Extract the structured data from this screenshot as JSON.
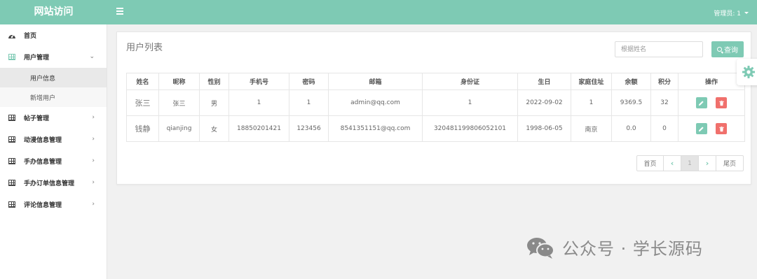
{
  "header": {
    "logo": "网站访问",
    "admin_label": "管理员: 1"
  },
  "sidebar": {
    "items": [
      {
        "label": "首页",
        "icon": "dashboard-icon"
      },
      {
        "label": "用户管理",
        "icon": "table-icon",
        "open": true,
        "children": [
          {
            "label": "用户信息",
            "active": true
          },
          {
            "label": "新增用户"
          }
        ]
      },
      {
        "label": "帖子管理",
        "icon": "table-icon"
      },
      {
        "label": "动漫信息管理",
        "icon": "table-icon"
      },
      {
        "label": "手办信息管理",
        "icon": "table-icon"
      },
      {
        "label": "手办订单信息管理",
        "icon": "table-icon"
      },
      {
        "label": "评论信息管理",
        "icon": "table-icon"
      }
    ]
  },
  "main": {
    "title": "用户列表",
    "search": {
      "placeholder": "根据姓名",
      "value": "",
      "button_label": "查询"
    },
    "table": {
      "headers": [
        "姓名",
        "昵称",
        "性别",
        "手机号",
        "密码",
        "邮箱",
        "身份证",
        "生日",
        "家庭住址",
        "余额",
        "积分",
        "操作"
      ],
      "rows": [
        [
          "张三",
          "张三",
          "男",
          "1",
          "1",
          "admin@qq.com",
          "1",
          "2022-09-02",
          "1",
          "9369.5",
          "32"
        ],
        [
          "钱静",
          "qianjing",
          "女",
          "18850201421",
          "123456",
          "8541351151@qq.com",
          "320481199806052101",
          "1998-06-05",
          "南京",
          "0.0",
          "0"
        ]
      ]
    },
    "pagination": {
      "first": "首页",
      "current": "1",
      "last": "尾页"
    }
  },
  "watermark": "公众号 · 学长源码",
  "colors": {
    "accent": "#7ecab4",
    "danger": "#f0706c"
  }
}
